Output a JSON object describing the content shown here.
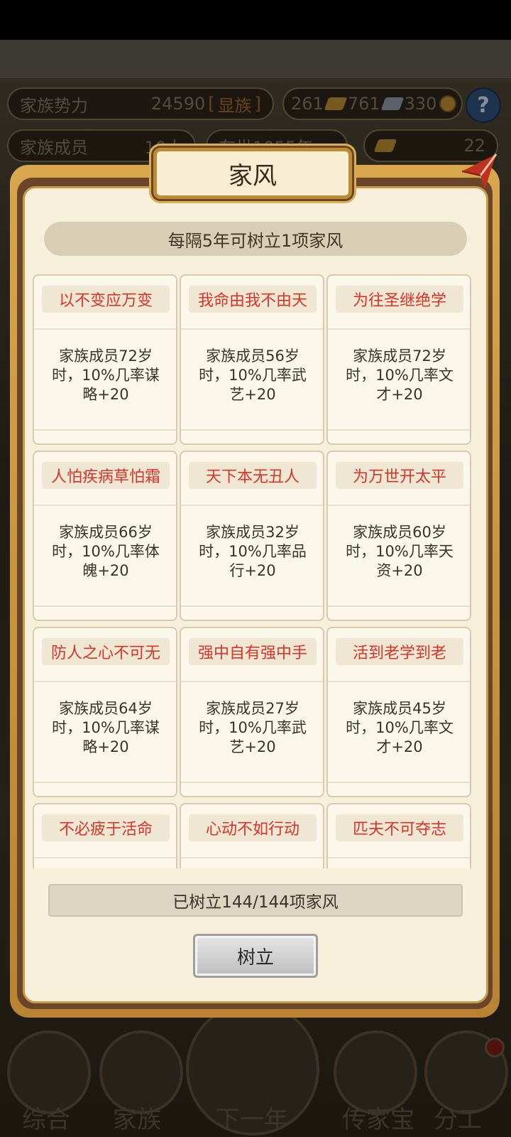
{
  "hud": {
    "family_power_label": "家族势力",
    "family_power_value": "24590",
    "family_rank_open": "[",
    "family_rank": "显族",
    "family_rank_close": "]",
    "gold_count": "261",
    "silver_count": "761",
    "coin_count": "330",
    "members_label": "家族成员",
    "members_value": "10人",
    "survival_label": "存世1055年",
    "ingot_count": "22",
    "help_icon": "?"
  },
  "dialog": {
    "title": "家风",
    "subtitle": "每隔5年可树立1项家风",
    "progress": "已树立144/144项家风",
    "establish_button": "树立",
    "cards": [
      {
        "title": "以不变应万变",
        "desc": [
          "家族成员72岁",
          "时，10%几率谋",
          "略+20"
        ]
      },
      {
        "title": "我命由我不由天",
        "desc": [
          "家族成员56岁",
          "时，10%几率武",
          "艺+20"
        ]
      },
      {
        "title": "为往圣继绝学",
        "desc": [
          "家族成员72岁",
          "时，10%几率文",
          "才+20"
        ]
      },
      {
        "title": "人怕疾病草怕霜",
        "desc": [
          "家族成员66岁",
          "时，10%几率体",
          "魄+20"
        ]
      },
      {
        "title": "天下本无丑人",
        "desc": [
          "家族成员32岁",
          "时，10%几率品",
          "行+20"
        ]
      },
      {
        "title": "为万世开太平",
        "desc": [
          "家族成员60岁",
          "时，10%几率天",
          "资+20"
        ]
      },
      {
        "title": "防人之心不可无",
        "desc": [
          "家族成员64岁",
          "时，10%几率谋",
          "略+20"
        ]
      },
      {
        "title": "强中自有强中手",
        "desc": [
          "家族成员27岁",
          "时，10%几率武",
          "艺+20"
        ]
      },
      {
        "title": "活到老学到老",
        "desc": [
          "家族成员45岁",
          "时，10%几率文",
          "才+20"
        ]
      },
      {
        "title": "不必疲于活命",
        "desc": []
      },
      {
        "title": "心动不如行动",
        "desc": []
      },
      {
        "title": "匹夫不可夺志",
        "desc": []
      }
    ]
  },
  "nav": {
    "items": [
      "综合",
      "家族",
      "下一年",
      "传家宝",
      "分工"
    ]
  }
}
